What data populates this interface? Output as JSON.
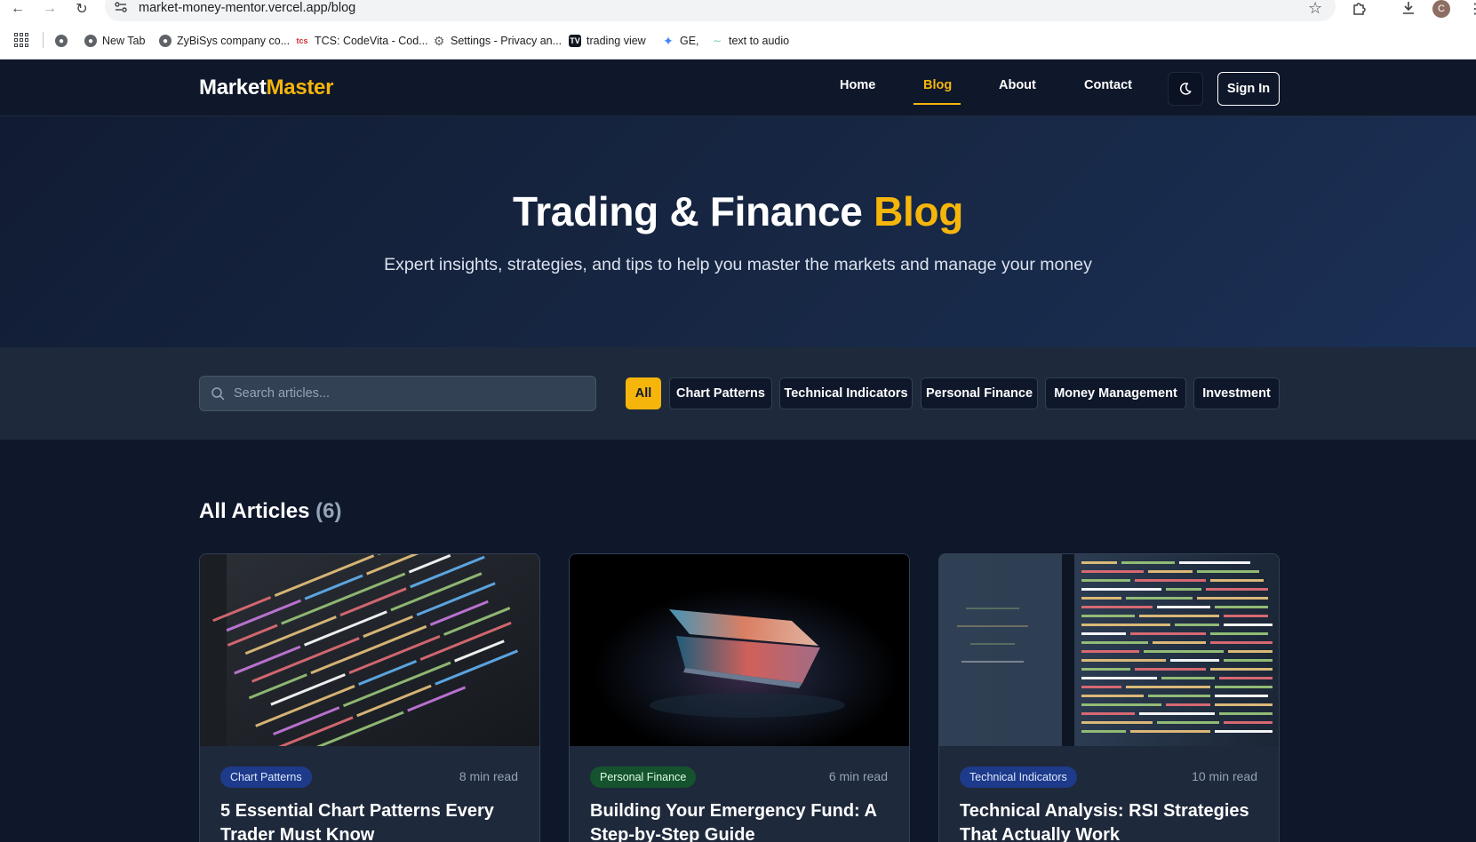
{
  "browser": {
    "url": "market-money-mentor.vercel.app/blog",
    "avatar_letter": "C",
    "bookmarks": [
      {
        "label": "New Tab"
      },
      {
        "label": "ZyBiSys company co..."
      },
      {
        "label": "TCS: CodeVita - Cod..."
      },
      {
        "label": "Settings - Privacy an..."
      },
      {
        "label": "trading view"
      },
      {
        "label": "GE,"
      },
      {
        "label": "text to audio"
      }
    ]
  },
  "header": {
    "logo_part1": "Market",
    "logo_part2": "Master",
    "nav": [
      {
        "label": "Home"
      },
      {
        "label": "Blog"
      },
      {
        "label": "About"
      },
      {
        "label": "Contact"
      }
    ],
    "signin_label": "Sign In"
  },
  "hero": {
    "title_main": "Trading & Finance",
    "title_highlight": "Blog",
    "subtitle": "Expert insights, strategies, and tips to help you master the markets and manage your money"
  },
  "filters": {
    "search_placeholder": "Search articles...",
    "chips": [
      {
        "label": "All"
      },
      {
        "label": "Chart Patterns"
      },
      {
        "label": "Technical Indicators"
      },
      {
        "label": "Personal Finance"
      },
      {
        "label": "Money Management"
      },
      {
        "label": "Investment"
      }
    ]
  },
  "articles": {
    "heading": "All Articles",
    "count": "(6)",
    "cards": [
      {
        "category": "Chart Patterns",
        "read_time": "8 min read",
        "title": "5 Essential Chart Patterns Every Trader Must Know"
      },
      {
        "category": "Personal Finance",
        "read_time": "6 min read",
        "title": "Building Your Emergency Fund: A Step-by-Step Guide"
      },
      {
        "category": "Technical Indicators",
        "read_time": "10 min read",
        "title": "Technical Analysis: RSI Strategies That Actually Work"
      }
    ]
  },
  "colors": {
    "accent": "#f5b50b",
    "background": "#0f172a",
    "surface": "#1e293b"
  }
}
